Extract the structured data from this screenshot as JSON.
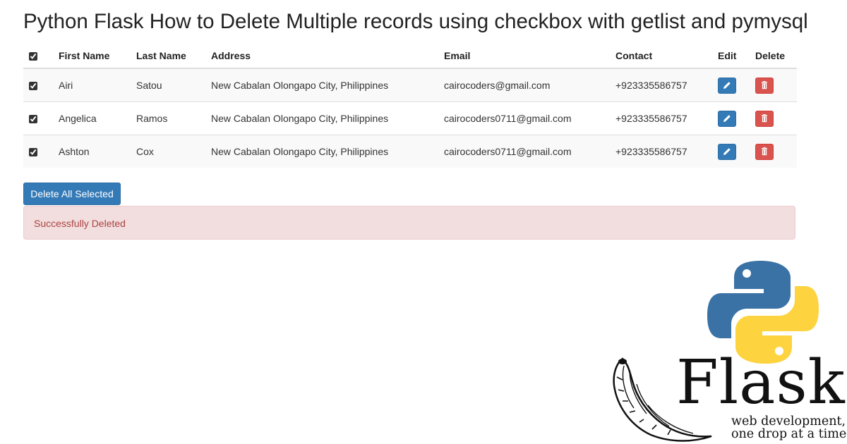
{
  "page": {
    "title": "Python Flask How to Delete Multiple records using checkbox with getlist and pymysql"
  },
  "table": {
    "columns": [
      "",
      "First Name",
      "Last Name",
      "Address",
      "Email",
      "Contact",
      "Edit",
      "Delete"
    ],
    "select_all_checked": true,
    "rows": [
      {
        "checked": true,
        "first_name": "Airi",
        "last_name": "Satou",
        "address": "New Cabalan Olongapo City, Philippines",
        "email": "cairocoders@gmail.com",
        "contact": "+923335586757"
      },
      {
        "checked": true,
        "first_name": "Angelica",
        "last_name": "Ramos",
        "address": "New Cabalan Olongapo City, Philippines",
        "email": "cairocoders0711@gmail.com",
        "contact": "+923335586757"
      },
      {
        "checked": true,
        "first_name": "Ashton",
        "last_name": "Cox",
        "address": "New Cabalan Olongapo City, Philippines",
        "email": "cairocoders0711@gmail.com",
        "contact": "+923335586757"
      }
    ],
    "edit_icon": "pencil-icon",
    "delete_icon": "trash-icon"
  },
  "actions": {
    "delete_all_label": "Delete All Selected"
  },
  "alert": {
    "message": "Successfully Deleted"
  },
  "logo": {
    "word": "Flask",
    "tagline_line1": "web development,",
    "tagline_line2": "one drop at a time"
  },
  "colors": {
    "primary": "#337ab7",
    "danger": "#d9534f",
    "alert_bg": "#f2dede",
    "alert_text": "#a94442",
    "python_blue": "#3a72a5",
    "python_yellow": "#fdd33f"
  }
}
